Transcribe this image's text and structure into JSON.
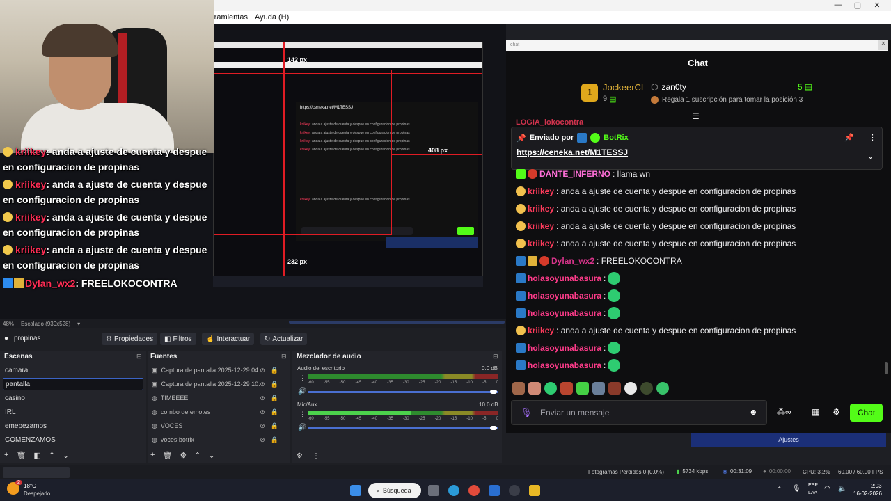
{
  "menu": {
    "items": [
      "rramientas",
      "Ayuda (H)"
    ]
  },
  "preview": {
    "overlay_chat": [
      {
        "user": "kriikey",
        "text": ": anda a ajuste de cuenta y despue",
        "cont": "en configuracion de propinas"
      },
      {
        "user": "kriikey",
        "text": ": anda a ajuste de cuenta y despue",
        "cont": "en configuracion de propinas"
      },
      {
        "user": "kriikey",
        "text": ": anda a ajuste de cuenta y despue",
        "cont": "en configuracion de propinas"
      },
      {
        "user": "kriikey",
        "text": ": anda a ajuste de cuenta y despue",
        "cont": "en configuracion de propinas"
      }
    ],
    "overlay_last": {
      "user": "Dylan_wx2",
      "text": ": FREELOKOCONTRA"
    },
    "dims": {
      "top": "142 px",
      "right": "408 px",
      "bottom": "232 px"
    },
    "inner_link": "https://ceneka.net/M1TESSJ"
  },
  "zoom": {
    "percent": "48%",
    "scale": "Escalado (939x528)"
  },
  "source_name": "propinas",
  "toolbar": {
    "properties": "Propiedades",
    "filters": "Filtros",
    "interact": "Interactuar",
    "refresh": "Actualizar"
  },
  "scenes": {
    "title": "Escenas",
    "items": [
      "camara",
      "pantalla",
      "casino",
      "IRL",
      "emepezamos",
      "COMENZAMOS"
    ],
    "active": "pantalla"
  },
  "sources": {
    "title": "Fuentes",
    "items": [
      "Captura de pantalla 2025-12-29 04:",
      "Captura de pantalla 2025-12-29 10:",
      "TIMEEEE",
      "combo de emotes",
      "VOCES",
      "voces botrix"
    ]
  },
  "mixer": {
    "title": "Mezclador de audio",
    "desktop": {
      "label": "Audio del escritorio",
      "db": "0.0 dB",
      "level": 0.0
    },
    "mic": {
      "label": "Mic/Aux",
      "db": "10.0 dB",
      "level": 0.0
    },
    "ticks": [
      "-60",
      "-55",
      "-50",
      "-45",
      "-40",
      "-35",
      "-30",
      "-25",
      "-20",
      "-15",
      "-10",
      "-5",
      "0"
    ]
  },
  "chat": {
    "address": "chat",
    "title": "Chat",
    "leaderboard": {
      "rank": "1",
      "top_user": "JockeerCL",
      "top_count": "9",
      "second_user": "zan0ty",
      "second_count": "5",
      "note": "Regala 1 suscripción para tomar la posición 3"
    },
    "cut_user": "LOGIA_lokocontra",
    "pinned": {
      "label": "Enviado por",
      "user": "BotRix",
      "link": "https://ceneka.net/M1TESSJ"
    },
    "messages": [
      {
        "user": "DANTE_INFERNO",
        "text": ": llama wn",
        "kind": "dante"
      },
      {
        "user": "kriikey",
        "text": ": anda a ajuste de cuenta y despue en configuracion de propinas",
        "kind": "k"
      },
      {
        "user": "kriikey",
        "text": ": anda a ajuste de cuenta y despue en configuracion de propinas",
        "kind": "k"
      },
      {
        "user": "kriikey",
        "text": ": anda a ajuste de cuenta y despue en configuracion de propinas",
        "kind": "k"
      },
      {
        "user": "kriikey",
        "text": ": anda a ajuste de cuenta y despue en configuracion de propinas",
        "kind": "k"
      },
      {
        "user": "Dylan_wx2",
        "text": ": FREELOKOCONTRA",
        "kind": "d"
      },
      {
        "user": "holasoyunabasura",
        "text": ":",
        "kind": "h"
      },
      {
        "user": "holasoyunabasura",
        "text": ":",
        "kind": "h"
      },
      {
        "user": "holasoyunabasura",
        "text": ":",
        "kind": "h"
      },
      {
        "user": "kriikey",
        "text": ": anda a ajuste de cuenta y despue en configuracion de propinas",
        "kind": "k"
      },
      {
        "user": "holasoyunabasura",
        "text": ":",
        "kind": "h"
      },
      {
        "user": "holasoyunabasura",
        "text": ":",
        "kind": "h"
      }
    ],
    "input_placeholder": "Enviar un mensaje",
    "send_label": "Chat",
    "settings_label": "Ajustes"
  },
  "status": {
    "dropped": "Fotogramas Perdidos 0 (0.0%)",
    "bitrate": "5734 kbps",
    "live_time": "00:31:09",
    "rec_time": "00:00:00",
    "cpu": "CPU: 3.2%",
    "fps": "60.00 / 60.00 FPS"
  },
  "taskbar": {
    "weather_temp": "18°C",
    "weather_desc": "Despejado",
    "weather_badge": "2",
    "search": "Búsqueda",
    "lang": "ESP",
    "lang_sub": "LAA",
    "time": "2:03",
    "date": "16-02-2026"
  }
}
